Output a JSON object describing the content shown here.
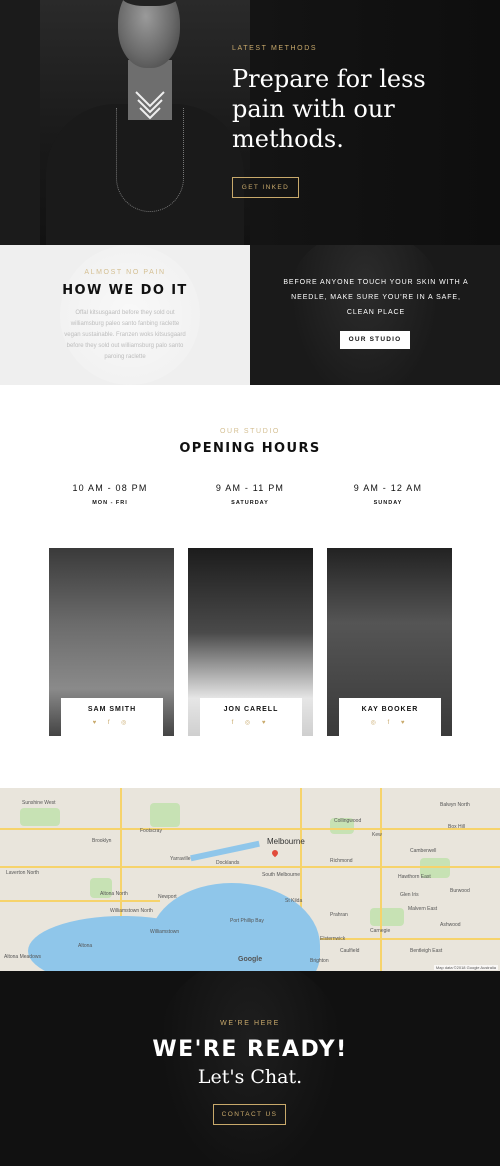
{
  "hero": {
    "eyebrow": "Latest Methods",
    "title": "Prepare for less pain with our methods.",
    "button": "Get Inked"
  },
  "how": {
    "eyebrow": "Almost no pain",
    "title": "HOW WE DO IT",
    "text": "Offal kitsusgaard before they sold out williamsburg paleo santo fanbing raclette vegan sustainable. Franzen woks kitsusgaard before they sold out williamsburg palo santo paroing raclette",
    "right_text": "Before anyone touch your skin with a needle, make sure you're in a safe, clean place",
    "button": "Our Studio"
  },
  "hours": {
    "eyebrow": "Our Studio",
    "title": "OPENING HOURS",
    "columns": [
      {
        "time": "10 AM - 08 PM",
        "day": "Mon - Fri"
      },
      {
        "time": "9 AM - 11 PM",
        "day": "Saturday"
      },
      {
        "time": "9 AM - 12 AM",
        "day": "Sunday"
      }
    ]
  },
  "team": [
    {
      "name": "Sam Smith",
      "socials": "♥ f ◎"
    },
    {
      "name": "Jon Carell",
      "socials": "f ◎ ♥"
    },
    {
      "name": "Kay Booker",
      "socials": "◎ f ♥"
    }
  ],
  "map": {
    "city": "Melbourne",
    "google": "Google",
    "footer": "Map data ©2018 Google   Australia",
    "labels": [
      "Sunshine West",
      "Brooklyn",
      "Footscray",
      "Yarraville",
      "Altona North",
      "Newport",
      "Williamstown",
      "Williamstown North",
      "Altona",
      "Altona Meadows",
      "Laverton North",
      "Port Phillip Bay",
      "Richmond",
      "Collingwood",
      "Hawthorn East",
      "Prahran",
      "Caulfield",
      "Bentleigh East",
      "Malvern East",
      "Box Hill",
      "Balwyn North",
      "Burwood",
      "Ashwood",
      "Carnegie",
      "Glen Iris",
      "Kew",
      "Camberwell",
      "South Melbourne",
      "Docklands",
      "Brighton",
      "Elsternwick",
      "St Kilda"
    ]
  },
  "ready": {
    "eyebrow": "We're Here",
    "title": "WE'RE READY!",
    "subtitle": "Let's Chat.",
    "button": "Contact Us"
  },
  "colors": {
    "gold": "#c8a96b",
    "dark": "#111111",
    "light_panel": "#efefef"
  }
}
